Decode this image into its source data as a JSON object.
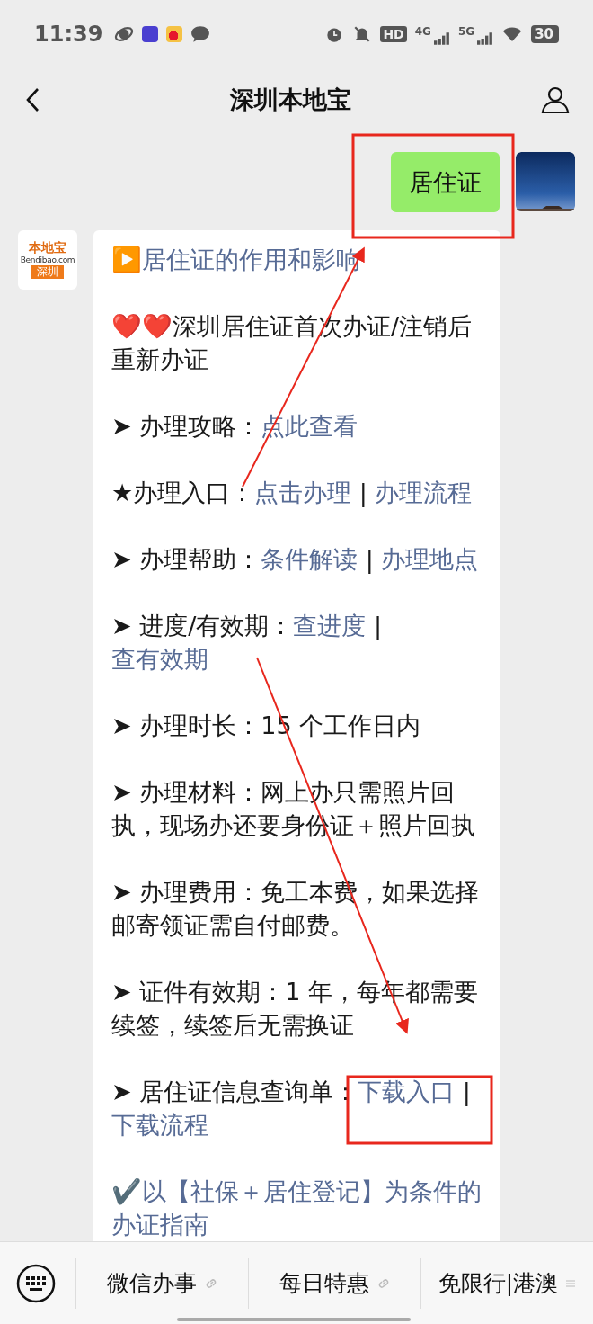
{
  "status_bar": {
    "time": "11:39",
    "indicators": [
      "HD",
      "4G",
      "5G"
    ],
    "battery": "30"
  },
  "header": {
    "title": "深圳本地宝"
  },
  "sent_message": {
    "text": "居住证"
  },
  "bot_logo": {
    "name": "本地宝",
    "site": "Bendibao.com",
    "city": "深圳"
  },
  "reply": {
    "paragraphs": [
      [
        {
          "kind": "link",
          "text": "▶️居住证的作用和影响"
        }
      ],
      [
        {
          "kind": "text",
          "text": "❤️❤️深圳居住证首次办证/注销后重新办证"
        }
      ],
      [
        {
          "kind": "text",
          "text": "➤ 办理攻略："
        },
        {
          "kind": "link",
          "text": "点此查看"
        }
      ],
      [
        {
          "kind": "text",
          "text": "★办理入口："
        },
        {
          "kind": "link",
          "text": "点击办理"
        },
        {
          "kind": "text",
          "text": " | "
        },
        {
          "kind": "link",
          "text": "办理流程"
        }
      ],
      [
        {
          "kind": "text",
          "text": "➤ 办理帮助："
        },
        {
          "kind": "link",
          "text": "条件解读"
        },
        {
          "kind": "text",
          "text": " | "
        },
        {
          "kind": "link",
          "text": "办理地点"
        }
      ],
      [
        {
          "kind": "text",
          "text": "➤ 进度/有效期："
        },
        {
          "kind": "link",
          "text": "查进度"
        },
        {
          "kind": "text",
          "text": " | "
        },
        {
          "kind": "link",
          "text": "查有效期"
        }
      ],
      [
        {
          "kind": "text",
          "text": "➤ 办理时长：15 个工作日内"
        }
      ],
      [
        {
          "kind": "text",
          "text": "➤ 办理材料：网上办只需照片回执，现场办还要身份证＋照片回执"
        }
      ],
      [
        {
          "kind": "text",
          "text": "➤ 办理费用：免工本费，如果选择邮寄领证需自付邮费。"
        }
      ],
      [
        {
          "kind": "text",
          "text": "➤ 证件有效期：1 年，每年都需要续签，续签后无需换证"
        }
      ],
      [
        {
          "kind": "text",
          "text": "➤ 居住证信息查询单："
        },
        {
          "kind": "link",
          "text": "下载入口"
        },
        {
          "kind": "text",
          "text": " | "
        },
        {
          "kind": "link",
          "text": "下载流程"
        }
      ],
      [
        {
          "kind": "link",
          "text": "✔️以【社保＋居住登记】为条件的办证指南"
        }
      ]
    ]
  },
  "menu": [
    {
      "kind": "link",
      "label": "微信办事"
    },
    {
      "kind": "link",
      "label": "每日特惠"
    },
    {
      "kind": "list",
      "label": "免限行|港澳"
    }
  ]
}
